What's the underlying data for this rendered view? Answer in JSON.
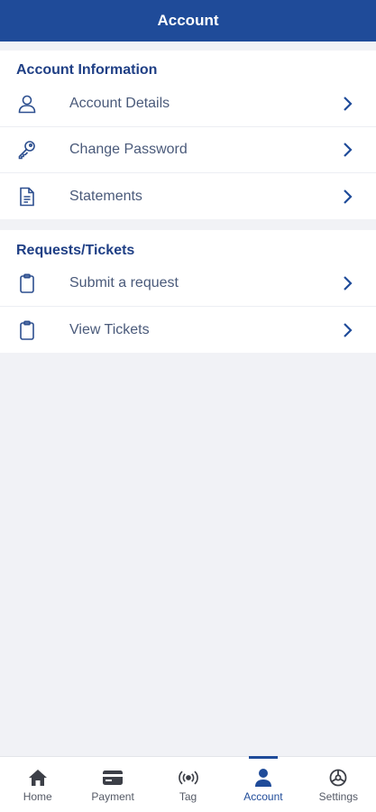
{
  "header": {
    "title": "Account"
  },
  "account_section": {
    "title": "Account Information",
    "items": [
      {
        "label": "Account Details",
        "icon": "user-icon"
      },
      {
        "label": "Change Password",
        "icon": "key-icon"
      },
      {
        "label": "Statements",
        "icon": "document-icon"
      }
    ]
  },
  "requests_section": {
    "title": "Requests/Tickets",
    "items": [
      {
        "label": "Submit a request",
        "icon": "clipboard-icon"
      },
      {
        "label": "View Tickets",
        "icon": "clipboard-icon"
      }
    ]
  },
  "tabbar": {
    "tabs": [
      {
        "label": "Home",
        "icon": "home-icon"
      },
      {
        "label": "Payment",
        "icon": "card-icon"
      },
      {
        "label": "Tag",
        "icon": "tag-signal-icon"
      },
      {
        "label": "Account",
        "icon": "person-icon",
        "active": true
      },
      {
        "label": "Settings",
        "icon": "settings-icon"
      }
    ]
  },
  "colors": {
    "brand": "#1f4b99",
    "title": "#1f3f85",
    "label": "#4a5a7a",
    "background": "#f1f2f6"
  }
}
